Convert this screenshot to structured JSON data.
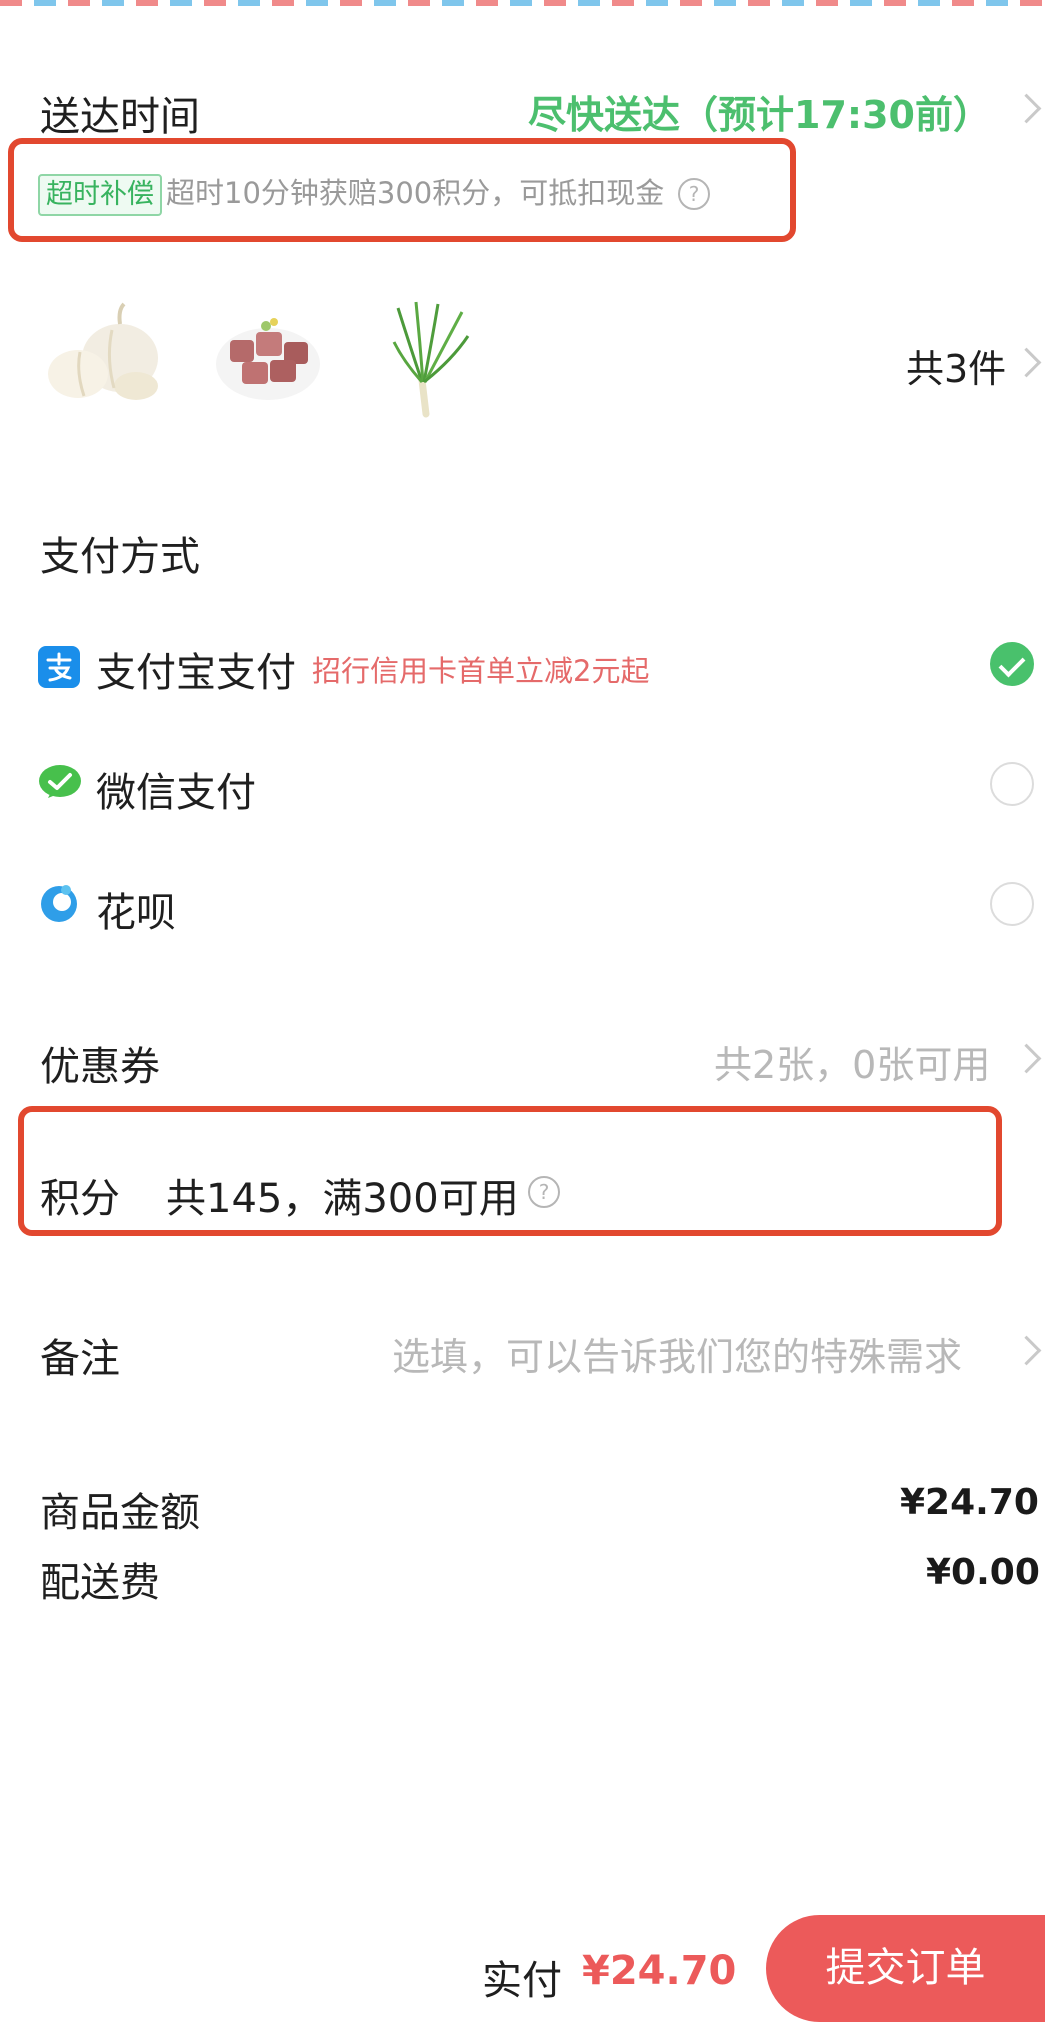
{
  "delivery": {
    "label": "送达时间",
    "eta": "尽快送达（预计17:30前）",
    "tag": "超时补偿",
    "note": "超时10分钟获赔300积分，可抵扣现金",
    "help_glyph": "?"
  },
  "items": {
    "products": [
      "garlic",
      "meat-cubes",
      "green-onion"
    ],
    "count_label": "共3件"
  },
  "payment": {
    "section_title": "支付方式",
    "options": [
      {
        "label": "支付宝支付",
        "promo": "招行信用卡首单立减2元起",
        "selected": true,
        "icon": "alipay-icon",
        "color": "#1a8eea"
      },
      {
        "label": "微信支付",
        "promo": "",
        "selected": false,
        "icon": "wechat-pay-icon",
        "color": "#47c04c"
      },
      {
        "label": "花呗",
        "promo": "",
        "selected": false,
        "icon": "huabei-icon",
        "color": "#2f9ee8"
      }
    ]
  },
  "coupon": {
    "label": "优惠券",
    "value": "共2张，0张可用"
  },
  "points": {
    "label": "积分",
    "value": "共145，满300可用",
    "help_glyph": "?"
  },
  "remark": {
    "label": "备注",
    "placeholder": "选填，可以告诉我们您的特殊需求"
  },
  "summary": {
    "goods_label": "商品金额",
    "goods_amount": "¥24.70",
    "shipping_label": "配送费",
    "shipping_amount": "¥0.00"
  },
  "footer": {
    "paid_label": "实付",
    "paid_amount": "¥24.70",
    "submit_label": "提交订单"
  },
  "colors": {
    "accent_green": "#4cbf6e",
    "accent_red": "#ec5a5a",
    "highlight_box": "#e2482f"
  }
}
